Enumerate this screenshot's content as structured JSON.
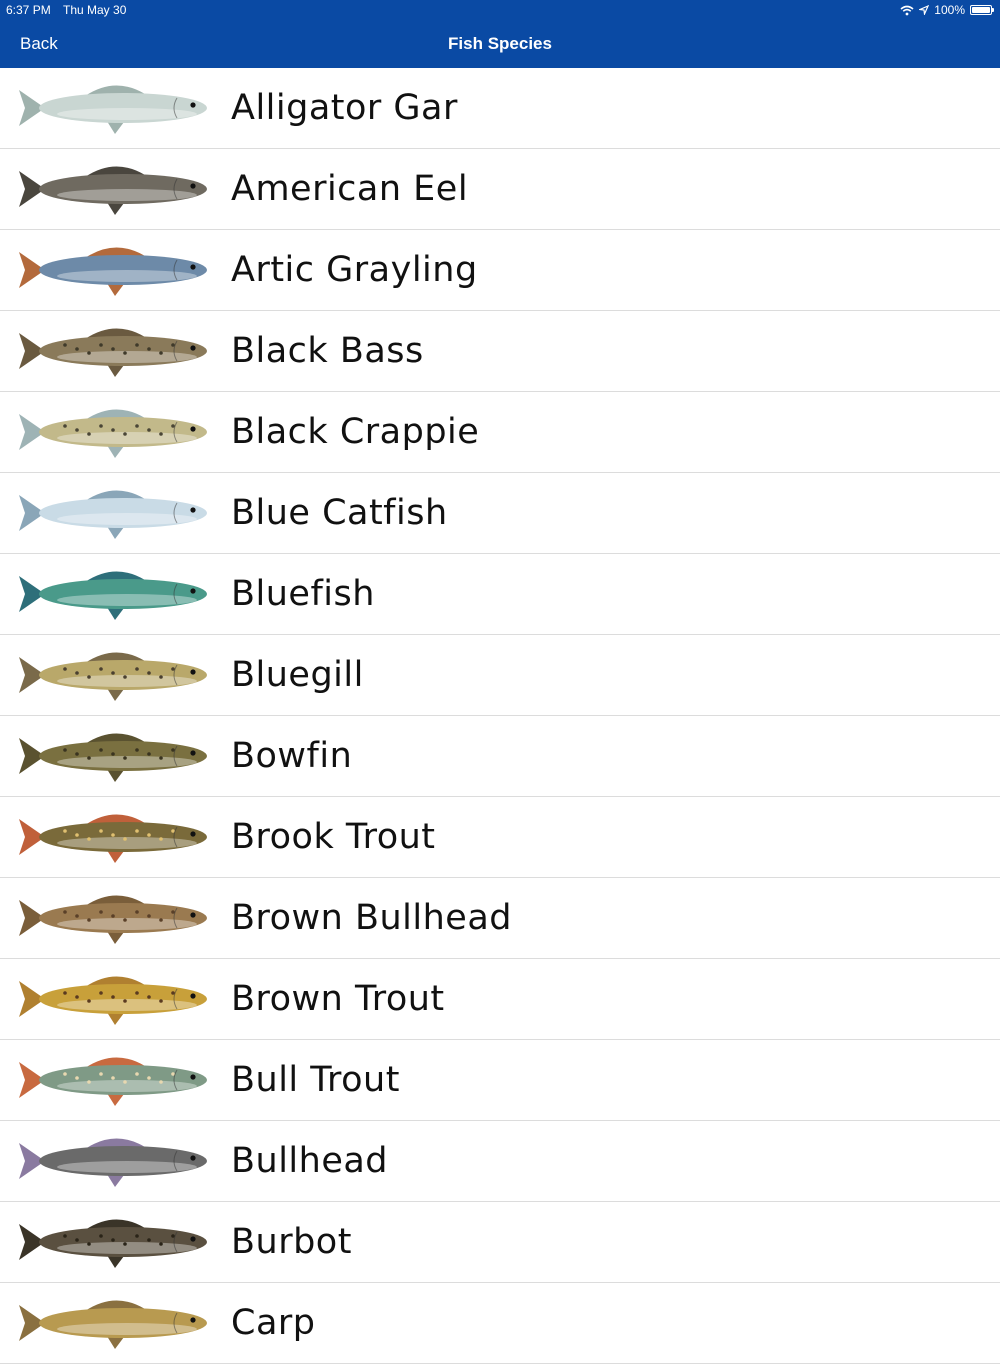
{
  "status_bar": {
    "time": "6:37 PM",
    "date": "Thu May 30",
    "battery": "100%",
    "icons": [
      "wifi-icon",
      "location-icon",
      "battery-icon"
    ]
  },
  "nav": {
    "back_label": "Back",
    "title": "Fish Species"
  },
  "colors": {
    "nav_bg": "#0a4aa4",
    "separator": "#dcdcdc"
  },
  "fish": [
    {
      "name": "Alligator Gar",
      "body": "#c9d6d2",
      "fin": "#9fb2ad",
      "spots": ""
    },
    {
      "name": "American Eel",
      "body": "#6f6a60",
      "fin": "#4a463e",
      "spots": ""
    },
    {
      "name": "Artic Grayling",
      "body": "#6d8aa8",
      "fin": "#b36a3c",
      "spots": ""
    },
    {
      "name": "Black Bass",
      "body": "#8a7a5a",
      "fin": "#6a5a40",
      "spots": "#3f3a2a"
    },
    {
      "name": "Black Crappie",
      "body": "#c2b98a",
      "fin": "#9eb3b5",
      "spots": "#4a4636"
    },
    {
      "name": "Blue Catfish",
      "body": "#c9dbe6",
      "fin": "#8aa6b8",
      "spots": ""
    },
    {
      "name": "Bluefish",
      "body": "#4a9a8a",
      "fin": "#2e6f7a",
      "spots": ""
    },
    {
      "name": "Bluegill",
      "body": "#b9a86a",
      "fin": "#7a6a4a",
      "spots": "#4a4030"
    },
    {
      "name": "Bowfin",
      "body": "#7a7040",
      "fin": "#5a5230",
      "spots": "#3a3420"
    },
    {
      "name": "Brook Trout",
      "body": "#7a6a3a",
      "fin": "#c0603a",
      "spots": "#e0c070"
    },
    {
      "name": "Brown Bullhead",
      "body": "#9a7a50",
      "fin": "#7a5e3a",
      "spots": "#5a4028"
    },
    {
      "name": "Brown Trout",
      "body": "#c8a03a",
      "fin": "#b08030",
      "spots": "#5a3a20"
    },
    {
      "name": "Bull Trout",
      "body": "#7f9a86",
      "fin": "#c86a40",
      "spots": "#e8d8b0"
    },
    {
      "name": "Bullhead",
      "body": "#6a6a6a",
      "fin": "#8a7aa0",
      "spots": ""
    },
    {
      "name": "Burbot",
      "body": "#5a5040",
      "fin": "#3a3428",
      "spots": "#2a2418"
    },
    {
      "name": "Carp",
      "body": "#b89a50",
      "fin": "#8a7040",
      "spots": ""
    }
  ]
}
